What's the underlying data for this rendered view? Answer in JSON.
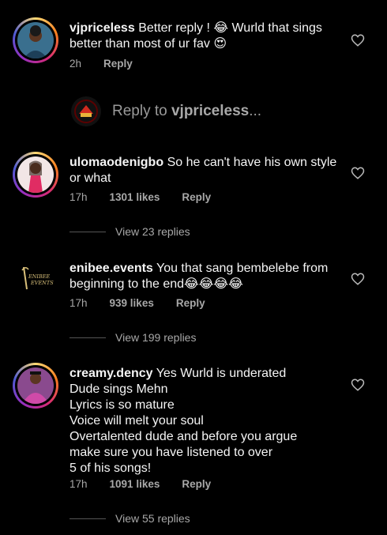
{
  "comments": [
    {
      "username": "vjpriceless",
      "text": "Better reply ! 😂 Wurld that sings better than most of ur fav 😍",
      "time": "2h",
      "likes": "",
      "reply": "Reply"
    },
    {
      "username": "ulomaodenigbo",
      "text": "So he can't have his own style or what",
      "time": "17h",
      "likes": "1301 likes",
      "reply": "Reply",
      "view_replies": "View 23 replies"
    },
    {
      "username": "enibee.events",
      "text": "You that sang bembelebe from beginning to the end😂😂😂😂",
      "time": "17h",
      "likes": "939 likes",
      "reply": "Reply",
      "view_replies": "View 199 replies",
      "avatar_text": "ENIBEE EVENTS"
    },
    {
      "username": "creamy.dency",
      "lines": [
        "Yes Wurld is underated",
        "Dude sings Mehn",
        "Lyrics is so mature",
        "Voice will melt your soul",
        "Overtalented dude and before you argue",
        "make sure you have listened to over",
        "5 of his songs!"
      ],
      "time": "17h",
      "likes": "1091 likes",
      "reply": "Reply",
      "view_replies": "View 55 replies"
    }
  ],
  "reply_to": {
    "prefix": "Reply to ",
    "username": "vjpriceless",
    "suffix": "..."
  },
  "icons": {
    "like": "heart-outline-icon",
    "avatar": "profile-picture"
  }
}
